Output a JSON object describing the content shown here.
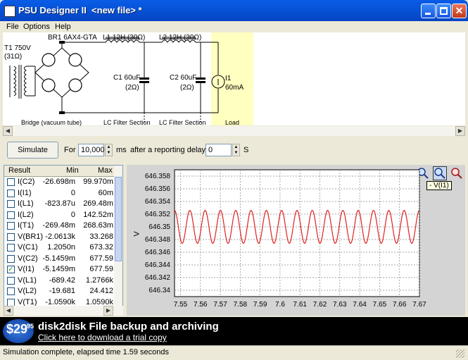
{
  "window": {
    "title": "PSU Designer II  <new file> *"
  },
  "menu": {
    "items": [
      "File",
      "Options",
      "Help"
    ]
  },
  "schematic": {
    "t1_label": "T1 750V",
    "t1_res": "(31Ω)",
    "br1_label": "BR1 6AX4-GTA",
    "l1_label": "L1 12H (30Ω)",
    "l2_label": "L2 12H (30Ω)",
    "c1_label": "C1 60uF",
    "c1_res": "(2Ω)",
    "c2_label": "C2 60uF",
    "c2_res": "(2Ω)",
    "i1_label": "I1",
    "i1_val": "60mA",
    "sections": [
      "Bridge (vacuum tube)",
      "LC Filter Section",
      "LC Filter Section",
      "Load"
    ]
  },
  "simulation": {
    "button": "Simulate",
    "for_label": "For",
    "duration": "10,000",
    "unit_ms": "ms",
    "delay_label": "after a reporting delay of",
    "delay": "0",
    "unit_s": "S"
  },
  "results": {
    "headers": [
      "Result",
      "Min",
      "Max"
    ],
    "rows": [
      {
        "name": "I(C2)",
        "min": "-26.698m",
        "max": "99.970m",
        "checked": false
      },
      {
        "name": "I(I1)",
        "min": "0",
        "max": "60m",
        "checked": false
      },
      {
        "name": "I(L1)",
        "min": "-823.87u",
        "max": "269.48m",
        "checked": false
      },
      {
        "name": "I(L2)",
        "min": "0",
        "max": "142.52m",
        "checked": false
      },
      {
        "name": "I(T1)",
        "min": "-269.48m",
        "max": "268.63m",
        "checked": false
      },
      {
        "name": "V(BR1)",
        "min": "-2.0613k",
        "max": "33.268",
        "checked": false
      },
      {
        "name": "V(C1)",
        "min": "1.2050n",
        "max": "673.32",
        "checked": false
      },
      {
        "name": "V(C2)",
        "min": "-5.1459m",
        "max": "677.59",
        "checked": false
      },
      {
        "name": "V(I1)",
        "min": "-5.1459m",
        "max": "677.59",
        "checked": true
      },
      {
        "name": "V(L1)",
        "min": "-689.42",
        "max": "1.2766k",
        "checked": false
      },
      {
        "name": "V(L2)",
        "min": "-19.681",
        "max": "24.412",
        "checked": false
      },
      {
        "name": "V(T1)",
        "min": "-1.0590k",
        "max": "1.0590k",
        "checked": false
      }
    ]
  },
  "graph": {
    "tooltip": "- V(I1)",
    "ylabel": "V",
    "y_ticks": [
      "646.358",
      "646.356",
      "646.354",
      "646.352",
      "646.35",
      "646.348",
      "646.346",
      "646.344",
      "646.342",
      "646.34"
    ],
    "x_ticks": [
      "7.55",
      "7.56",
      "7.57",
      "7.58",
      "7.59",
      "7.6",
      "7.61",
      "7.62",
      "7.63",
      "7.64",
      "7.65",
      "7.66",
      "7.67"
    ],
    "trace_color": "#e02020"
  },
  "chart_data": {
    "type": "line",
    "series": [
      {
        "name": "V(I1)",
        "x_range": [
          7.547,
          7.67
        ],
        "mean": 646.35,
        "amplitude": 0.0026,
        "cycles": 16
      }
    ],
    "xlim": [
      7.547,
      7.67
    ],
    "ylim": [
      646.339,
      646.359
    ],
    "grid": true,
    "ylabel": "V"
  },
  "banner": {
    "price": "$29",
    "cents": "95",
    "title": "disk2disk File backup and archiving",
    "link": "Click here to download a trial copy"
  },
  "status": {
    "text": "Simulation complete, elapsed time 1.59 seconds"
  }
}
